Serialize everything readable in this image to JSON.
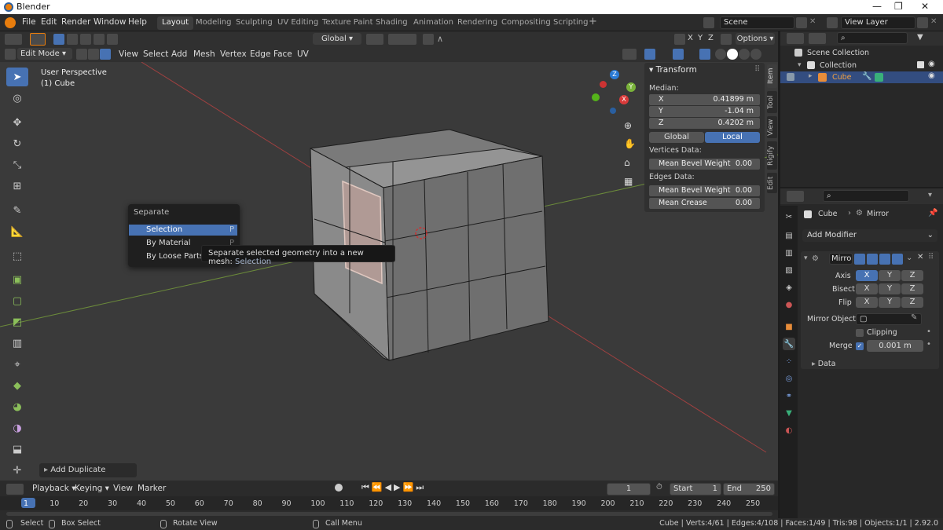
{
  "title_bar": {
    "app_title": "Blender"
  },
  "menu_bar": {
    "menus": [
      "File",
      "Edit",
      "Render",
      "Window",
      "Help"
    ],
    "workspaces": [
      "Layout",
      "Modeling",
      "Sculpting",
      "UV Editing",
      "Texture Paint",
      "Shading",
      "Animation",
      "Rendering",
      "Compositing",
      "Scripting"
    ],
    "active_workspace": "Layout",
    "scene": "Scene",
    "view_layer": "View Layer"
  },
  "tool_header": {
    "orientation": "Global",
    "options_label": "Options",
    "axes": [
      "X",
      "Y",
      "Z"
    ]
  },
  "viewport_header": {
    "mode": "Edit Mode",
    "menus": [
      "View",
      "Select",
      "Add",
      "Mesh",
      "Vertex",
      "Edge",
      "Face",
      "UV"
    ]
  },
  "viewport": {
    "perspective_label": "User Perspective",
    "object_label": "(1) Cube",
    "gizmo_axes": [
      "Z",
      "Y",
      "X"
    ]
  },
  "separate_menu": {
    "title": "Separate",
    "items": [
      {
        "label": "Selection",
        "key": "P"
      },
      {
        "label": "By Material",
        "key": "P"
      },
      {
        "label": "By Loose Parts",
        "key": "P"
      }
    ],
    "selected_index": 0
  },
  "tooltip": {
    "text": "Separate selected geometry into a new mesh:",
    "value": "Selection"
  },
  "last_operator": {
    "label": "Add Duplicate"
  },
  "n_panel": {
    "section": "Transform",
    "median_label": "Median:",
    "x_label": "X",
    "x_value": "0.41899 m",
    "y_label": "Y",
    "y_value": "-1.04 m",
    "z_label": "Z",
    "z_value": "0.4202 m",
    "global_label": "Global",
    "local_label": "Local",
    "active_space": "Local",
    "vertices_data_label": "Vertices Data:",
    "v_bevel_label": "Mean Bevel Weight",
    "v_bevel_value": "0.00",
    "edges_data_label": "Edges Data:",
    "e_bevel_label": "Mean Bevel Weight",
    "e_bevel_value": "0.00",
    "crease_label": "Mean Crease",
    "crease_value": "0.00",
    "tabs": [
      "Item",
      "Tool",
      "View",
      "Rigify",
      "Edit"
    ],
    "active_tab": "Item"
  },
  "outliner": {
    "scene_collection": "Scene Collection",
    "collection": "Collection",
    "object": "Cube"
  },
  "properties": {
    "object_name": "Cube",
    "modifier_name": "Mirror",
    "add_modifier_label": "Add Modifier",
    "modifier_field": "Mirro",
    "axis_label": "Axis",
    "bisect_label": "Bisect",
    "flip_label": "Flip",
    "axes": [
      "X",
      "Y",
      "Z"
    ],
    "mirror_object_label": "Mirror Object",
    "clipping_label": "Clipping",
    "clipping_checked": false,
    "merge_label": "Merge",
    "merge_checked": true,
    "merge_value": "0.001 m",
    "data_label": "Data"
  },
  "timeline": {
    "menus": [
      "Playback",
      "Keying",
      "View",
      "Marker"
    ],
    "current_frame": "1",
    "start_label": "Start",
    "start_value": "1",
    "end_label": "End",
    "end_value": "250",
    "ticks": [
      "1",
      "10",
      "20",
      "30",
      "40",
      "50",
      "60",
      "70",
      "80",
      "90",
      "100",
      "110",
      "120",
      "130",
      "140",
      "150",
      "160",
      "170",
      "180",
      "190",
      "200",
      "210",
      "220",
      "230",
      "240",
      "250"
    ]
  },
  "status_bar": {
    "select": "Select",
    "box_select": "Box Select",
    "rotate_view": "Rotate View",
    "call_menu": "Call Menu",
    "stats": "Cube | Verts:4/61 | Edges:4/108 | Faces:1/49 | Tris:98 | Objects:1/1 | 2.92.0"
  },
  "colors": {
    "accent": "#4772b3",
    "orange": "#e87d0d",
    "viewport_bg": "#3a3a3a"
  }
}
